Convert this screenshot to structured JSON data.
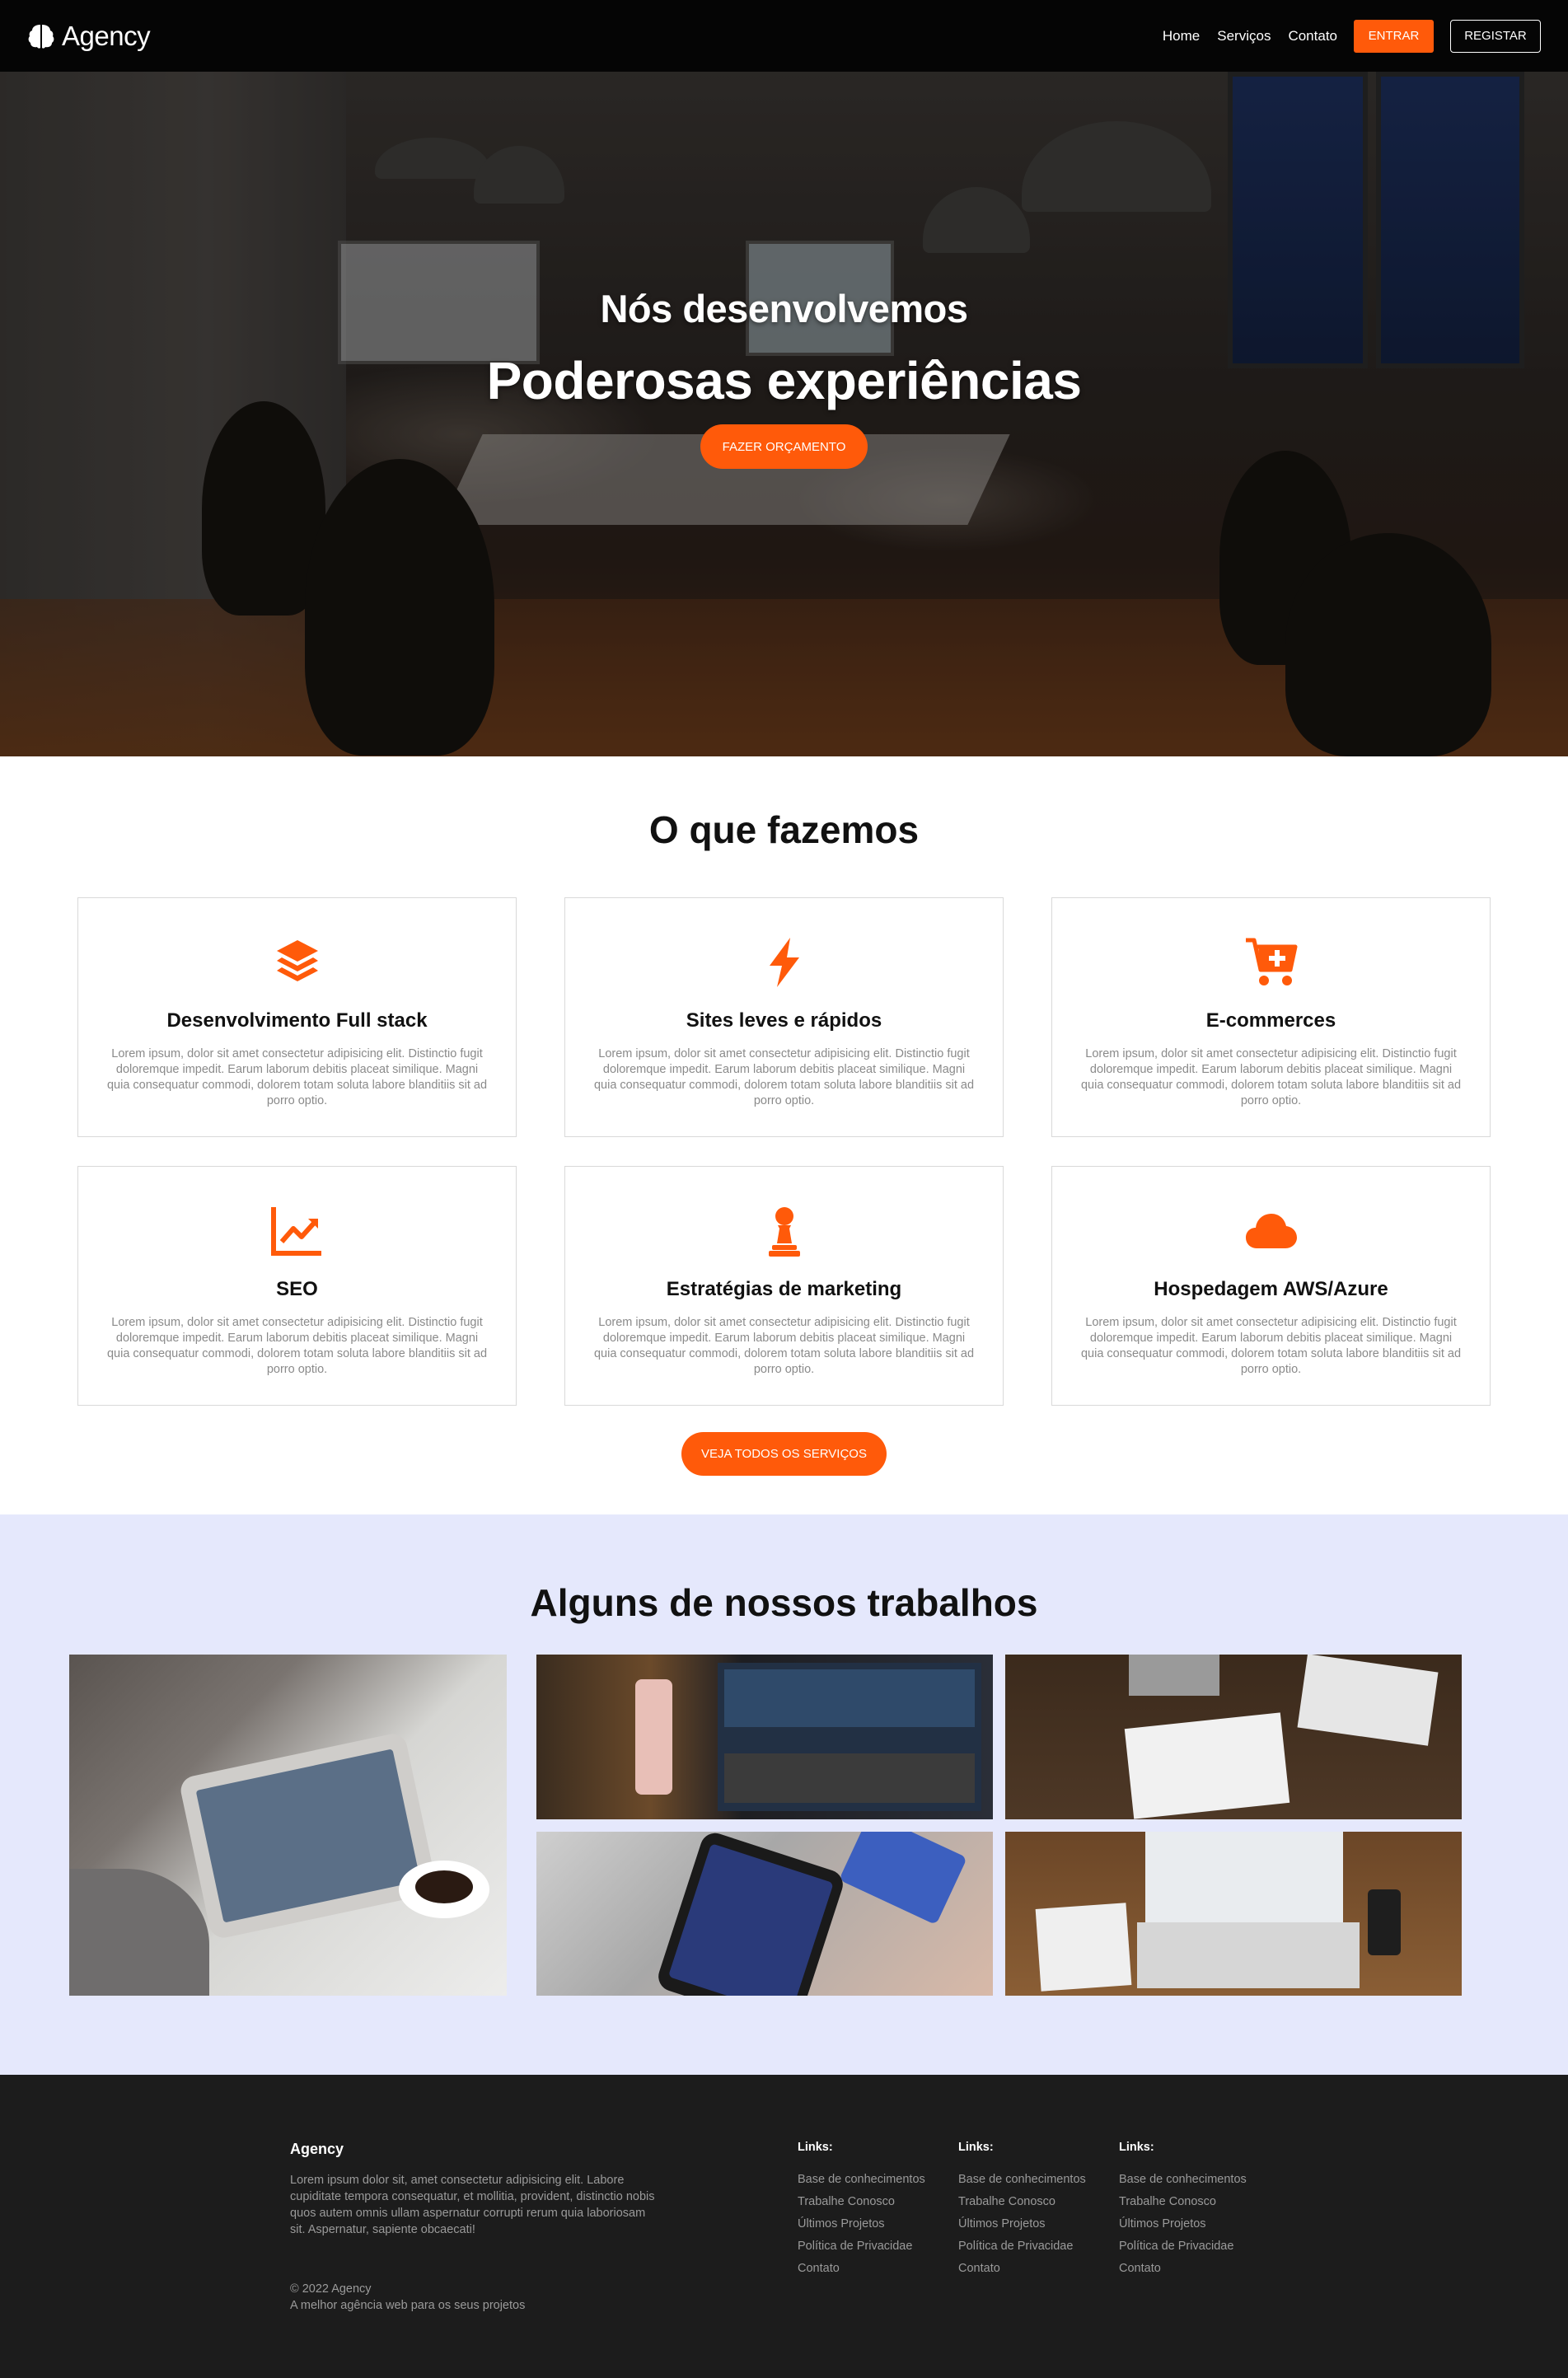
{
  "nav": {
    "brand": "Agency",
    "links": [
      "Home",
      "Serviços",
      "Contato"
    ],
    "login_label": "ENTRAR",
    "register_label": "REGISTAR"
  },
  "hero": {
    "subtitle": "Nós desenvolvemos",
    "title": "Poderosas experiências",
    "cta_label": "FAZER ORÇAMENTO"
  },
  "services": {
    "title": "O que fazemos",
    "items": [
      {
        "icon": "layers-icon",
        "title": "Desenvolvimento Full stack",
        "desc": "Lorem ipsum, dolor sit amet consectetur adipisicing elit. Distinctio fugit doloremque impedit. Earum laborum debitis placeat similique. Magni quia consequatur commodi, dolorem totam soluta labore blanditiis sit ad porro optio."
      },
      {
        "icon": "bolt-icon",
        "title": "Sites leves e rápidos",
        "desc": "Lorem ipsum, dolor sit amet consectetur adipisicing elit. Distinctio fugit doloremque impedit. Earum laborum debitis placeat similique. Magni quia consequatur commodi, dolorem totam soluta labore blanditiis sit ad porro optio."
      },
      {
        "icon": "cart-plus-icon",
        "title": "E-commerces",
        "desc": "Lorem ipsum, dolor sit amet consectetur adipisicing elit. Distinctio fugit doloremque impedit. Earum laborum debitis placeat similique. Magni quia consequatur commodi, dolorem totam soluta labore blanditiis sit ad porro optio."
      },
      {
        "icon": "chart-line-icon",
        "title": "SEO",
        "desc": "Lorem ipsum, dolor sit amet consectetur adipisicing elit. Distinctio fugit doloremque impedit. Earum laborum debitis placeat similique. Magni quia consequatur commodi, dolorem totam soluta labore blanditiis sit ad porro optio."
      },
      {
        "icon": "chess-pawn-icon",
        "title": "Estratégias de marketing",
        "desc": "Lorem ipsum, dolor sit amet consectetur adipisicing elit. Distinctio fugit doloremque impedit. Earum laborum debitis placeat similique. Magni quia consequatur commodi, dolorem totam soluta labore blanditiis sit ad porro optio."
      },
      {
        "icon": "cloud-icon",
        "title": "Hospedagem AWS/Azure",
        "desc": "Lorem ipsum, dolor sit amet consectetur adipisicing elit. Distinctio fugit doloremque impedit. Earum laborum debitis placeat similique. Magni quia consequatur commodi, dolorem totam soluta labore blanditiis sit ad porro optio."
      }
    ],
    "cta_label": "VEJA TODOS OS SERVIÇOS"
  },
  "portfolio": {
    "title": "Alguns de nossos trabalhos"
  },
  "footer": {
    "brand": "Agency",
    "text": "Lorem ipsum dolor sit, amet consectetur adipisicing elit. Labore cupiditate tempora consequatur, et mollitia, provident, distinctio nobis quos autem omnis ullam aspernatur corrupti rerum quia laboriosam sit. Aspernatur, sapiente obcaecati!",
    "copyright": "© 2022 Agency",
    "tagline": "A melhor agência web para os seus projetos",
    "columns": [
      {
        "heading": "Links:",
        "links": [
          "Base de conhecimentos",
          "Trabalhe Conosco",
          "Últimos Projetos",
          "Política de Privacidae",
          "Contato"
        ]
      },
      {
        "heading": "Links:",
        "links": [
          "Base de conhecimentos",
          "Trabalhe Conosco",
          "Últimos Projetos",
          "Política de Privacidae",
          "Contato"
        ]
      },
      {
        "heading": "Links:",
        "links": [
          "Base de conhecimentos",
          "Trabalhe Conosco",
          "Últimos Projetos",
          "Política de Privacidae",
          "Contato"
        ]
      }
    ]
  },
  "colors": {
    "accent": "#ff5a0a",
    "nav_bg": "#050505",
    "portfolio_bg": "#e5e8fc",
    "footer_bg": "#1c1c1c"
  }
}
